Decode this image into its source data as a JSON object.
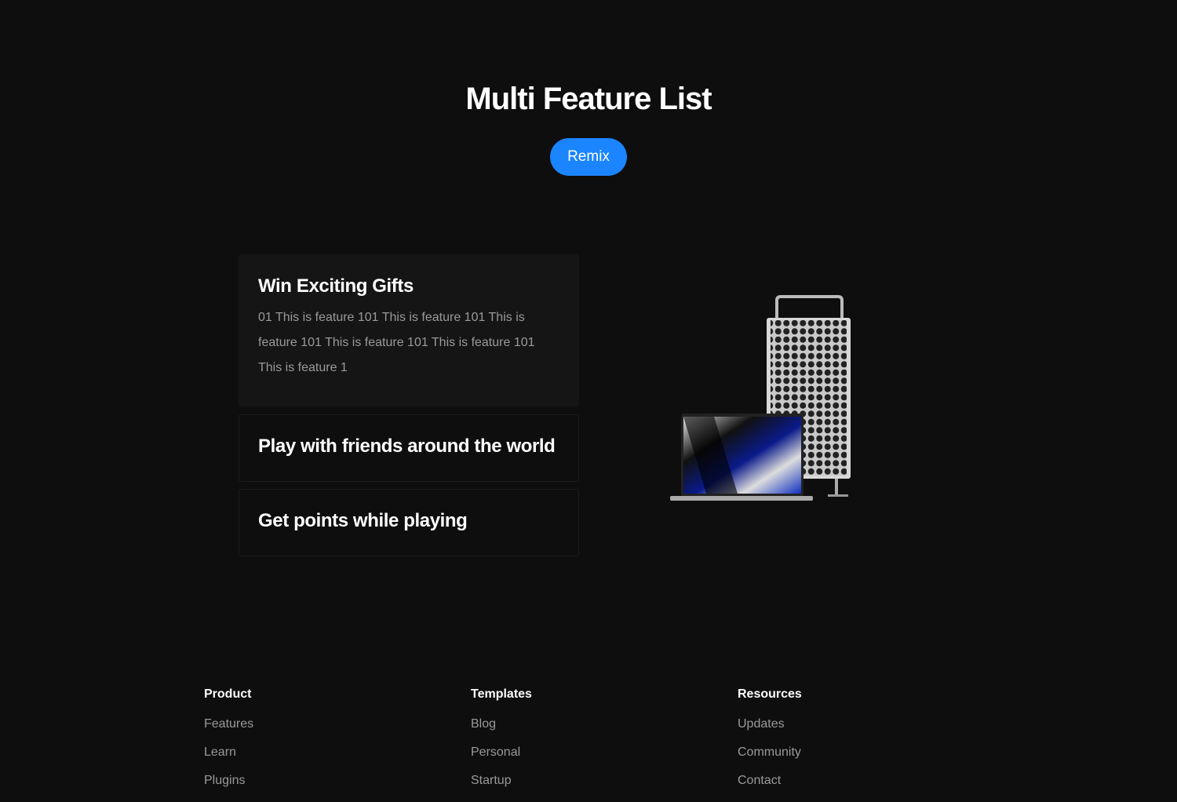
{
  "header": {
    "title": "Multi Feature List",
    "remix_label": "Remix"
  },
  "features": [
    {
      "title": "Win Exciting Gifts",
      "description": "01 This is feature 101 This is feature 101 This is feature 101 This is feature 101 This is feature 101 This is feature 1",
      "active": true
    },
    {
      "title": "Play with friends around the world",
      "active": false
    },
    {
      "title": "Get points while playing",
      "active": false
    }
  ],
  "footer": {
    "columns": [
      {
        "heading": "Product",
        "links": [
          "Features",
          "Learn",
          "Plugins"
        ]
      },
      {
        "heading": "Templates",
        "links": [
          "Blog",
          "Personal",
          "Startup"
        ]
      },
      {
        "heading": "Resources",
        "links": [
          "Updates",
          "Community",
          "Contact"
        ]
      }
    ]
  },
  "colors": {
    "accent": "#1a85ff",
    "background": "#0e0e0e"
  }
}
